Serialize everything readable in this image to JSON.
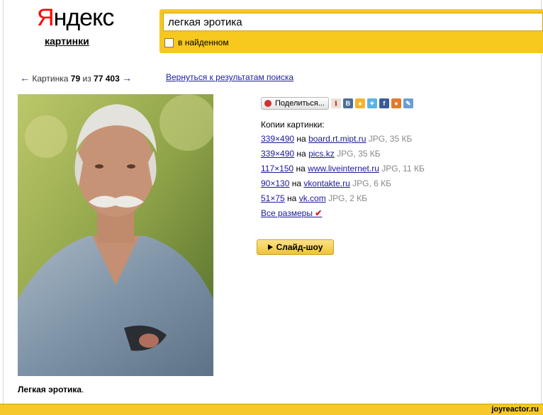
{
  "header": {
    "logo_first": "Я",
    "logo_rest": "ндекс",
    "section": "картинки",
    "search_value": "легкая эротика",
    "in_found_label": "в найденном"
  },
  "nav": {
    "prev_arrow": "←",
    "image_label": "Картинка",
    "current": "79",
    "of": "из",
    "total": "77 403",
    "next_arrow": "→",
    "back_link": "Вернуться к результатам поиска"
  },
  "image": {
    "caption": "Легкая эротика",
    "caption_end": "."
  },
  "share": {
    "button_label": "Поделиться...",
    "vk_label": "В",
    "fb_label": "f"
  },
  "copies": {
    "title": "Копии картинки:",
    "on": "на",
    "items": [
      {
        "size": "339×490",
        "site": "board.rt.mipt.ru",
        "meta": "JPG, 35 КБ"
      },
      {
        "size": "339×490",
        "site": "pics.kz",
        "meta": "JPG, 35 КБ"
      },
      {
        "size": "117×150",
        "site": "www.liveinternet.ru",
        "meta": "JPG, 11 КБ"
      },
      {
        "size": "90×130",
        "site": "vkontakte.ru",
        "meta": "JPG, 6 КБ"
      },
      {
        "size": "51×75",
        "site": "vk.com",
        "meta": "JPG, 2 КБ"
      }
    ],
    "all_sizes": "Все размеры"
  },
  "slideshow_label": "Слайд-шоу",
  "footer": {
    "watermark": "joyreactor.ru"
  },
  "colors": {
    "yellow": "#f7c81d",
    "link": "#1a1a9a",
    "logo_red": "#ff0000"
  }
}
